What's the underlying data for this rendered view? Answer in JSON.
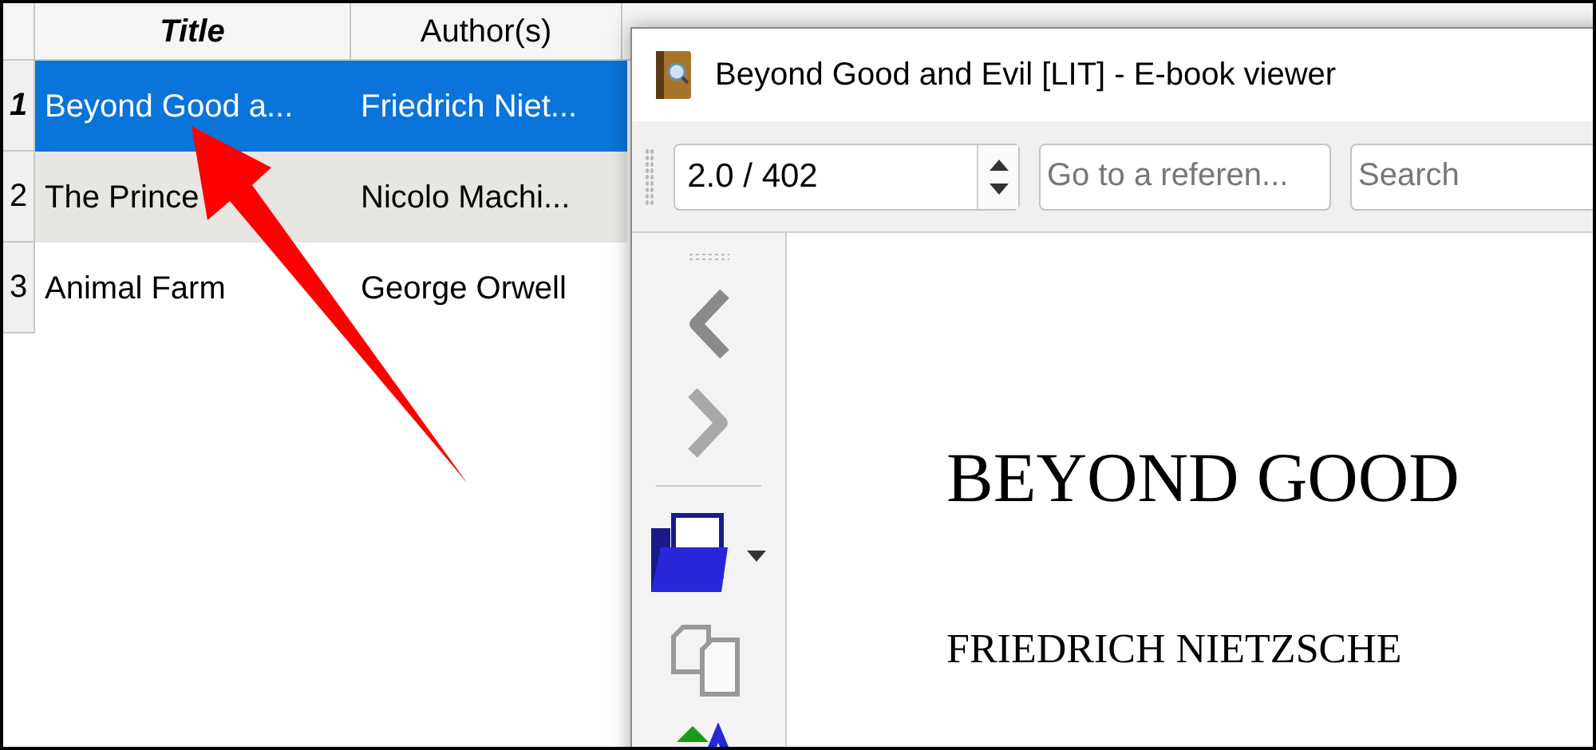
{
  "table": {
    "columns": [
      {
        "label": "Title",
        "sorted": true
      },
      {
        "label": "Author(s)",
        "sorted": false
      }
    ],
    "rows": [
      {
        "number": "1",
        "title": "Beyond Good a...",
        "author": "Friedrich Niet...",
        "selected": true
      },
      {
        "number": "2",
        "title": "The Prince",
        "author": "Nicolo Machi...",
        "selected": false
      },
      {
        "number": "3",
        "title": "Animal Farm",
        "author": "George Orwell",
        "selected": false
      }
    ]
  },
  "viewer": {
    "window_title": "Beyond Good and Evil [LIT] - E-book viewer",
    "page_field": "2.0 / 402",
    "reference_field": {
      "placeholder": "Go to a referen..."
    },
    "search_field": {
      "placeholder": "Search"
    },
    "book_lines": [
      "BEYOND GOOD",
      "FRIEDRICH NIETZSCHE"
    ]
  }
}
